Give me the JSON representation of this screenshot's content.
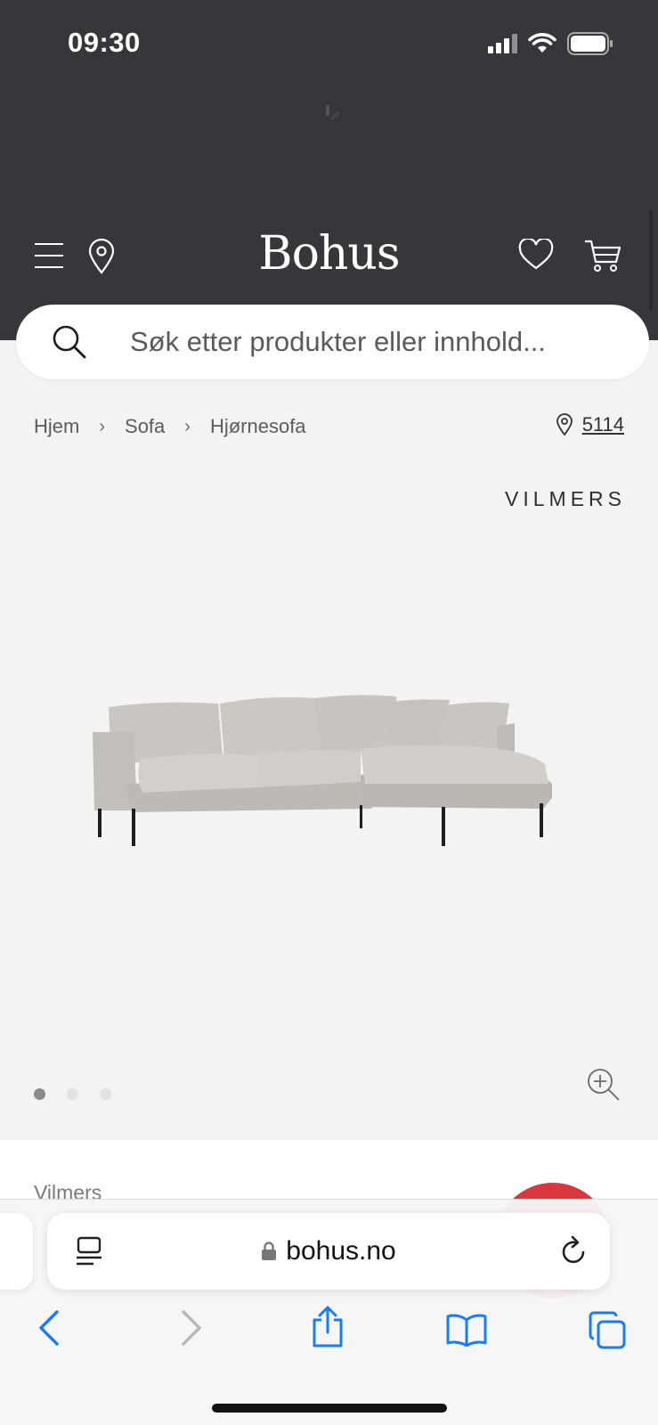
{
  "status_bar": {
    "time": "09:30"
  },
  "header": {
    "logo": "Bohus",
    "icons": [
      "menu-icon",
      "location-pin-icon",
      "heart-icon",
      "cart-icon"
    ]
  },
  "search": {
    "placeholder": "Søk etter produkter eller innhold..."
  },
  "breadcrumb": {
    "items": [
      "Hjem",
      "Sofa",
      "Hjørnesofa"
    ],
    "separator": "›"
  },
  "store": {
    "number": "5114"
  },
  "product": {
    "brand": "VILMERS",
    "vendor": "Vilmers",
    "image_count": 3,
    "active_image": 1
  },
  "browser": {
    "url": "bohus.no"
  },
  "colors": {
    "header_bg": "#36363b",
    "page_bg": "#f4f3f1",
    "accent_red": "#d9373d",
    "ios_blue": "#1a7cf5"
  }
}
